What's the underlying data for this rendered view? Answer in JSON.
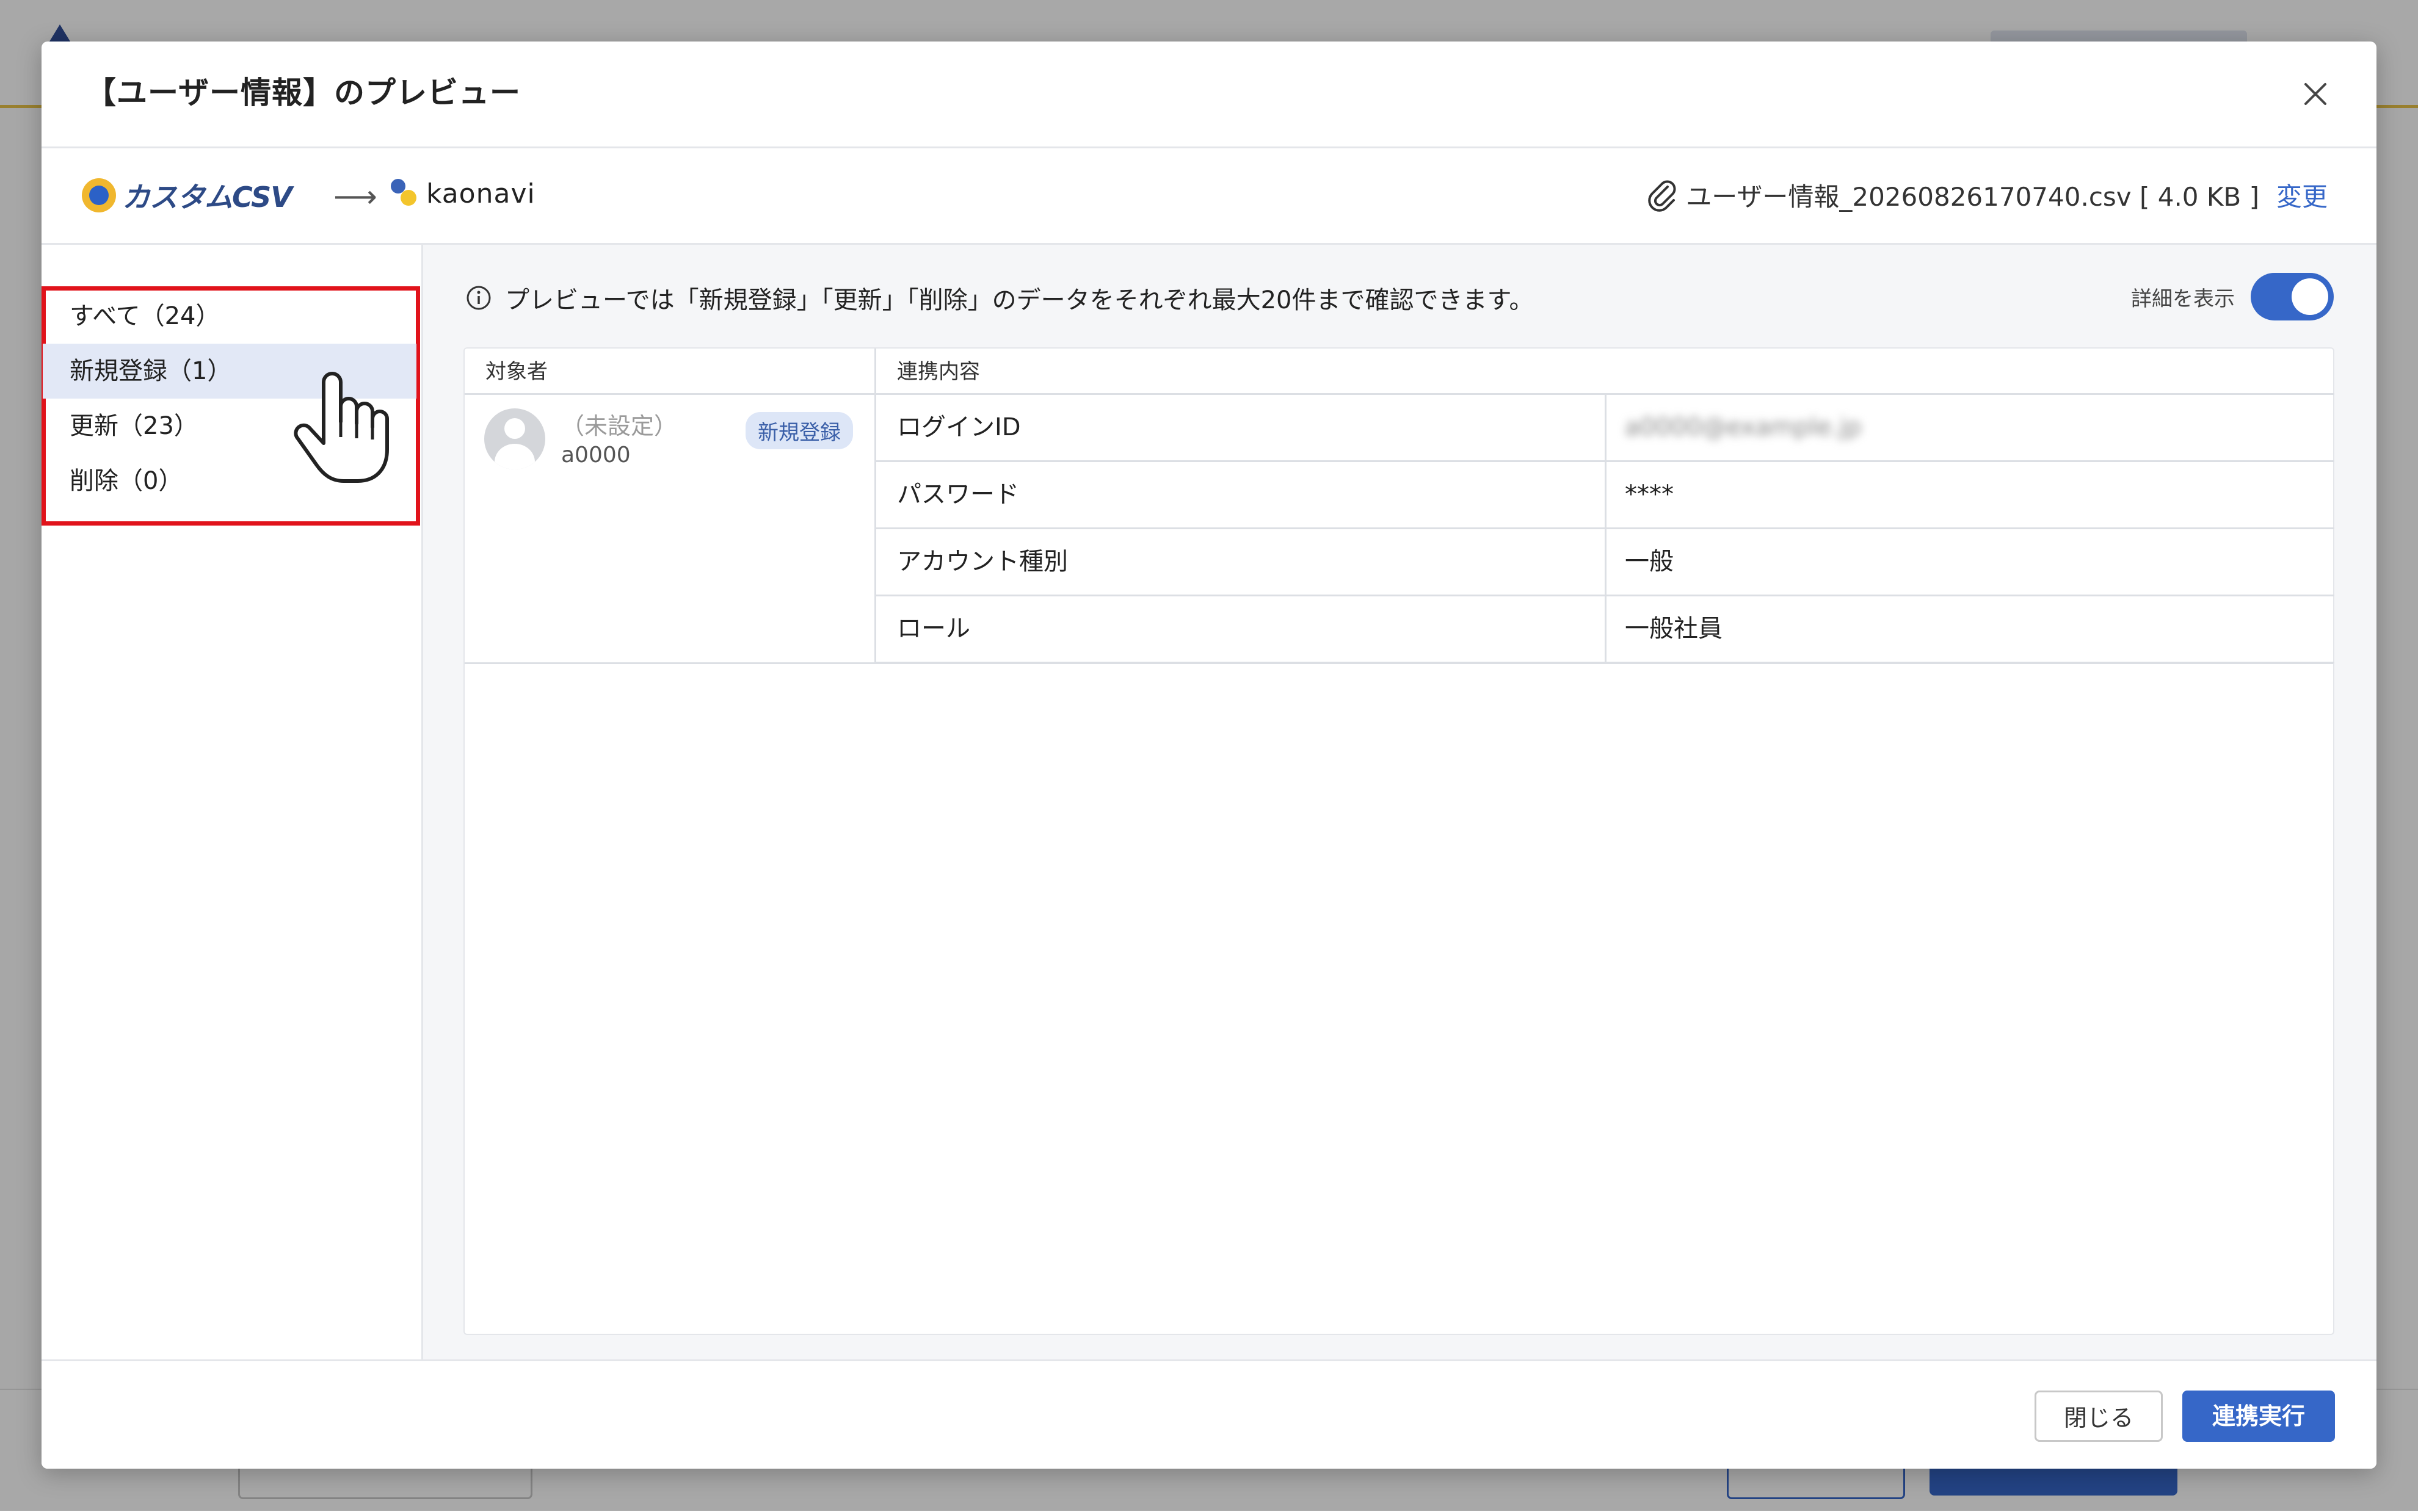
{
  "modal": {
    "title": "【ユーザー情報】のプレビュー",
    "close_icon": "close-icon"
  },
  "connection": {
    "source_name": "カスタムCSV",
    "arrow": "⟶",
    "destination_name": "kaonavi",
    "file_label": "ユーザー情報_20260826170740.csv [ 4.0 KB ]",
    "change_label": "変更"
  },
  "filters": [
    {
      "label": "すべて（24）"
    },
    {
      "label": "新規登録（1）"
    },
    {
      "label": "更新（23）"
    },
    {
      "label": "削除（0）"
    }
  ],
  "notice": "プレビューでは「新規登録」「更新」「削除」のデータをそれぞれ最大20件まで確認できます。",
  "detail_toggle": {
    "label": "詳細を表示",
    "on": true
  },
  "table": {
    "col_target": "対象者",
    "col_content": "連携内容",
    "person": {
      "name": "（未設定）",
      "id": "a0000",
      "badge": "新規登録"
    },
    "rows": [
      {
        "key": "ログインID",
        "value": "a0000@example.jp"
      },
      {
        "key": "パスワード",
        "value": "****"
      },
      {
        "key": "アカウント種別",
        "value": "一般"
      },
      {
        "key": "ロール",
        "value": "一般社員"
      }
    ]
  },
  "footer": {
    "close_label": "閉じる",
    "execute_label": "連携実行"
  },
  "colors": {
    "accent": "#3667c8",
    "highlight": "#e1131b",
    "active_row": "#e2e8f6"
  }
}
